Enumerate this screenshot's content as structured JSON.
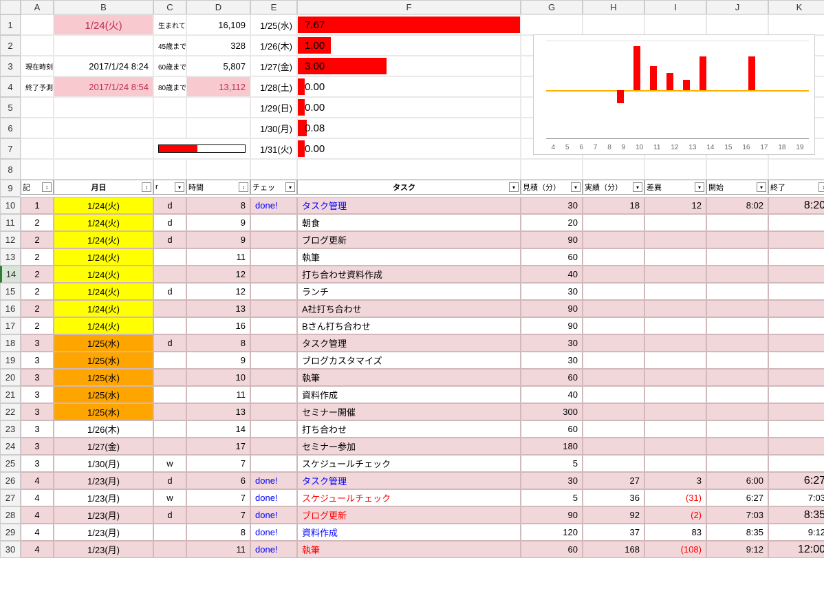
{
  "cols": [
    "A",
    "B",
    "C",
    "D",
    "E",
    "F",
    "G",
    "H",
    "I",
    "J",
    "K"
  ],
  "rows": [
    1,
    2,
    3,
    4,
    5,
    6,
    7,
    8,
    9,
    10,
    11,
    12,
    13,
    14,
    15,
    16,
    17,
    18,
    19,
    20,
    21,
    22,
    23,
    24,
    25,
    26,
    27,
    28,
    29,
    30
  ],
  "top": {
    "b1": "1/24(火)",
    "c1": "生まれてから",
    "d1": "16,109",
    "c2": "45歳まで",
    "d2": "328",
    "a3": "現在時刻",
    "b3": "2017/1/24 8:24",
    "c3": "60歳まで",
    "d3": "5,807",
    "a4": "終了予測",
    "b4": "2017/1/24 8:54",
    "c4": "80歳まで",
    "d4": "13,112"
  },
  "days": [
    {
      "e": "1/25(水)",
      "f": "7.67",
      "w": 100
    },
    {
      "e": "1/26(木)",
      "f": "1.00",
      "w": 15
    },
    {
      "e": "1/27(金)",
      "f": "3.00",
      "w": 40
    },
    {
      "e": "1/28(土)",
      "f": "0.00",
      "w": 3
    },
    {
      "e": "1/29(日)",
      "f": "0.00",
      "w": 3
    },
    {
      "e": "1/30(月)",
      "f": "0.08",
      "w": 4
    },
    {
      "e": "1/31(火)",
      "f": "0.00",
      "w": 3
    }
  ],
  "progress_pct": 45,
  "chart_data": {
    "type": "bar",
    "title": "",
    "categories": [
      4,
      5,
      6,
      7,
      8,
      9,
      10,
      11,
      12,
      13,
      14,
      15,
      16,
      17,
      18,
      19
    ],
    "values": [
      0,
      0,
      0,
      0,
      -20,
      65,
      35,
      25,
      15,
      50,
      0,
      0,
      50,
      0,
      0,
      0
    ],
    "baseline": 0
  },
  "headers": {
    "a": "記",
    "b": "月日",
    "c": "r",
    "d": "時間",
    "e": "チェッ",
    "f": "タスク",
    "g": "見積（分）",
    "h": "実績（分）",
    "i": "差異",
    "j": "開始",
    "k": "終了"
  },
  "done_label": "done!",
  "tasks": [
    {
      "n": 1,
      "date": "1/24(火)",
      "dc": "yellow",
      "c": "d",
      "t": 8,
      "done": true,
      "task": "タスク管理",
      "tc": "blue",
      "g": 30,
      "h": 18,
      "i": "12",
      "j": "8:02",
      "k": "8:20",
      "kbig": true,
      "pink": true
    },
    {
      "n": 2,
      "date": "1/24(火)",
      "dc": "yellow",
      "c": "d",
      "t": 9,
      "task": "朝食",
      "g": 20
    },
    {
      "n": 2,
      "date": "1/24(火)",
      "dc": "yellow",
      "c": "d",
      "t": 9,
      "task": "ブログ更新",
      "g": 90,
      "pink": true
    },
    {
      "n": 2,
      "date": "1/24(火)",
      "dc": "yellow",
      "t": 11,
      "task": "執筆",
      "g": 60
    },
    {
      "n": 2,
      "date": "1/24(火)",
      "dc": "yellow",
      "t": 12,
      "task": "打ち合わせ資料作成",
      "g": 40,
      "pink": true,
      "sel": true
    },
    {
      "n": 2,
      "date": "1/24(火)",
      "dc": "yellow",
      "c": "d",
      "t": 12,
      "task": "ランチ",
      "g": 30
    },
    {
      "n": 2,
      "date": "1/24(火)",
      "dc": "yellow",
      "t": 13,
      "task": "A社打ち合わせ",
      "g": 90,
      "pink": true
    },
    {
      "n": 2,
      "date": "1/24(火)",
      "dc": "yellow",
      "t": 16,
      "task": "Bさん打ち合わせ",
      "g": 90
    },
    {
      "n": 3,
      "date": "1/25(水)",
      "dc": "orange",
      "c": "d",
      "t": 8,
      "task": "タスク管理",
      "g": 30,
      "pink": true
    },
    {
      "n": 3,
      "date": "1/25(水)",
      "dc": "orange",
      "t": 9,
      "task": "ブログカスタマイズ",
      "g": 30
    },
    {
      "n": 3,
      "date": "1/25(水)",
      "dc": "orange",
      "t": 10,
      "task": "執筆",
      "g": 60,
      "pink": true
    },
    {
      "n": 3,
      "date": "1/25(水)",
      "dc": "orange",
      "t": 11,
      "task": "資料作成",
      "g": 40
    },
    {
      "n": 3,
      "date": "1/25(水)",
      "dc": "orange",
      "t": 13,
      "task": "セミナー開催",
      "g": 300,
      "pink": true
    },
    {
      "n": 3,
      "date": "1/26(木)",
      "t": 14,
      "task": "打ち合わせ",
      "g": 60
    },
    {
      "n": 3,
      "date": "1/27(金)",
      "t": 17,
      "task": "セミナー参加",
      "g": 180,
      "pink": true
    },
    {
      "n": 3,
      "date": "1/30(月)",
      "c": "w",
      "t": 7,
      "task": "スケジュールチェック",
      "g": 5
    },
    {
      "n": 4,
      "date": "1/23(月)",
      "c": "d",
      "t": 6,
      "done": true,
      "task": "タスク管理",
      "tc": "blue",
      "g": 30,
      "h": 27,
      "i": "3",
      "j": "6:00",
      "k": "6:27",
      "kbig": true,
      "pink": true
    },
    {
      "n": 4,
      "date": "1/23(月)",
      "c": "w",
      "t": 7,
      "done": true,
      "task": "スケジュールチェック",
      "tc": "red",
      "g": 5,
      "h": 36,
      "i": "(31)",
      "ir": true,
      "j": "6:27",
      "k": "7:03"
    },
    {
      "n": 4,
      "date": "1/23(月)",
      "c": "d",
      "t": 7,
      "done": true,
      "task": "ブログ更新",
      "tc": "red",
      "g": 90,
      "h": 92,
      "i": "(2)",
      "ir": true,
      "j": "7:03",
      "k": "8:35",
      "kbig": true,
      "pink": true
    },
    {
      "n": 4,
      "date": "1/23(月)",
      "t": 8,
      "done": true,
      "task": "資料作成",
      "tc": "blue",
      "g": 120,
      "h": 37,
      "i": "83",
      "j": "8:35",
      "k": "9:12"
    },
    {
      "n": 4,
      "date": "1/23(月)",
      "t": 11,
      "done": true,
      "task": "執筆",
      "tc": "red",
      "g": 60,
      "h": 168,
      "i": "(108)",
      "ir": true,
      "j": "9:12",
      "k": "12:00",
      "kbig": true,
      "pink": true
    }
  ]
}
